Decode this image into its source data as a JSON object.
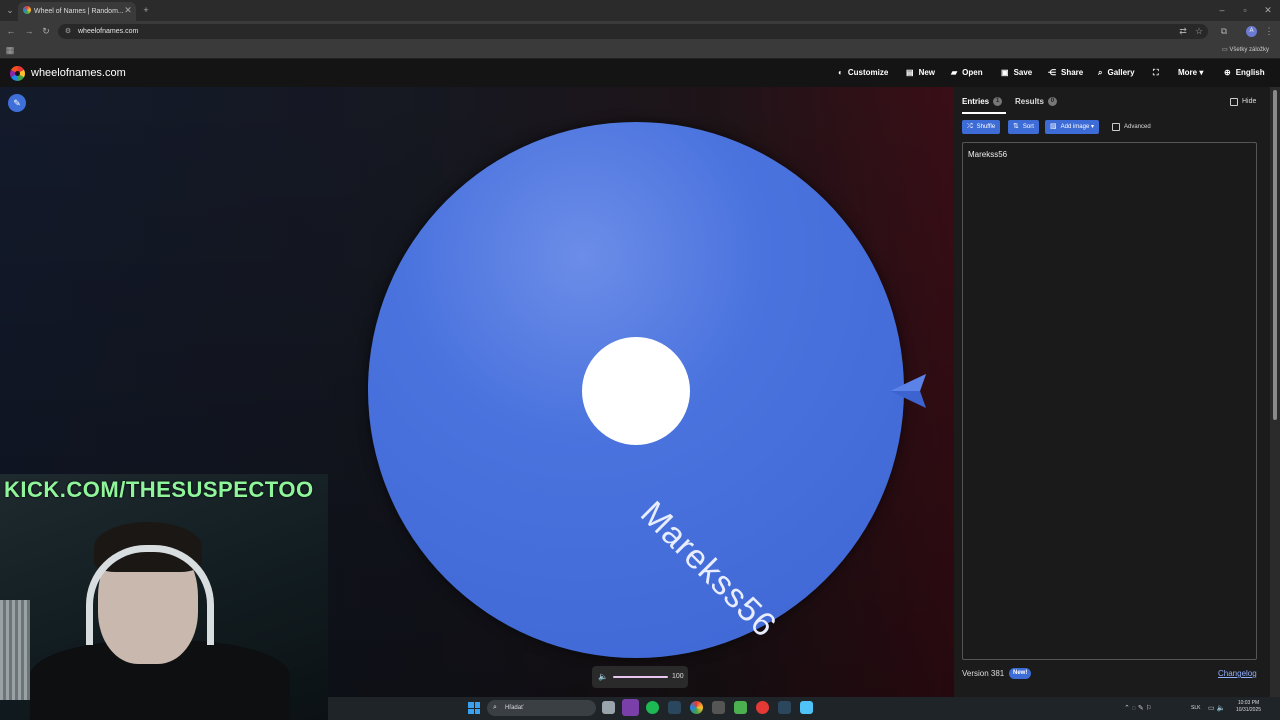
{
  "browser": {
    "tab_title": "Wheel of Names | Random...",
    "url": "wheelofnames.com",
    "bookmarks_folder": "Všetky záložky",
    "profile_initial": "A"
  },
  "site": {
    "brand": "wheelofnames.com",
    "nav": [
      {
        "label": "Customize",
        "icon": "palette-icon"
      },
      {
        "label": "New",
        "icon": "file-icon"
      },
      {
        "label": "Open",
        "icon": "folder-icon"
      },
      {
        "label": "Save",
        "icon": "save-icon"
      },
      {
        "label": "Share",
        "icon": "share-icon"
      },
      {
        "label": "Gallery",
        "icon": "search-icon"
      },
      {
        "label": "",
        "icon": "fullscreen-icon"
      },
      {
        "label": "More",
        "icon": "chevron-down-icon"
      },
      {
        "label": "English",
        "icon": "globe-icon"
      }
    ]
  },
  "wheel": {
    "segment_label": "Marekss56",
    "color": "#4a73de"
  },
  "volume": {
    "value": "100",
    "level": 1.0
  },
  "overlay": {
    "stream_text": "KICK.COM/THESUSPECTOO"
  },
  "panel": {
    "tabs": [
      {
        "label": "Entries",
        "count": "1"
      },
      {
        "label": "Results",
        "count": "0"
      }
    ],
    "hide_label": "Hide",
    "buttons": {
      "shuffle": "Shuffle",
      "sort": "Sort",
      "add_image": "Add image"
    },
    "advanced_label": "Advanced",
    "entries_text": "Marekss56",
    "version": "Version 381",
    "new_badge": "New!",
    "changelog": "Changelog"
  },
  "taskbar": {
    "search_placeholder": "Hľadať",
    "lang": "SLK",
    "time": "10:03 PM",
    "date": "10/31/2025"
  },
  "colors": {
    "accent": "#3e6cd6",
    "nav_bg": "#141414",
    "overlay_text": "#8ff59a"
  }
}
